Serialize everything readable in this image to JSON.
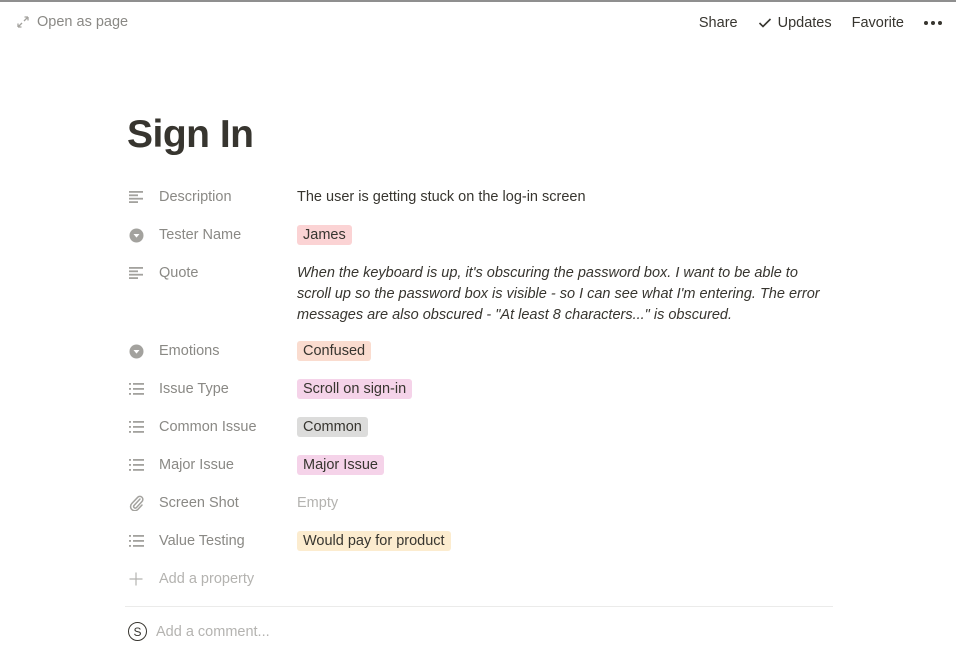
{
  "topbar": {
    "open_as_page": "Open as page",
    "share": "Share",
    "updates": "Updates",
    "favorite": "Favorite"
  },
  "page": {
    "title": "Sign In"
  },
  "properties": [
    {
      "icon": "text-icon",
      "label": "Description",
      "type": "text",
      "value": "The user is getting stuck on the log-in screen"
    },
    {
      "icon": "select-icon",
      "label": "Tester Name",
      "type": "tag",
      "value": "James",
      "color": "#fbd3d4"
    },
    {
      "icon": "text-icon",
      "label": "Quote",
      "type": "quote",
      "value": "When the keyboard is up, it's obscuring the password box. I want to be able to scroll up so the password box is visible - so I can see what I'm entering. The error messages are also obscured - \"At least 8 characters...\" is obscured."
    },
    {
      "icon": "select-icon",
      "label": "Emotions",
      "type": "tag",
      "value": "Confused",
      "color": "#fadccf"
    },
    {
      "icon": "multi-select-icon",
      "label": "Issue Type",
      "type": "tag",
      "value": "Scroll on sign-in",
      "color": "#f5d3e9"
    },
    {
      "icon": "multi-select-icon",
      "label": "Common Issue",
      "type": "tag",
      "value": "Common",
      "color": "#dcdcdb"
    },
    {
      "icon": "multi-select-icon",
      "label": "Major Issue",
      "type": "tag",
      "value": "Major Issue",
      "color": "#f5d3e9"
    },
    {
      "icon": "attachment-icon",
      "label": "Screen Shot",
      "type": "empty",
      "value": "Empty"
    },
    {
      "icon": "multi-select-icon",
      "label": "Value Testing",
      "type": "tag",
      "value": "Would pay for product",
      "color": "#fceccf"
    }
  ],
  "add_property": "Add a property",
  "comment": {
    "avatar_initial": "S",
    "placeholder": "Add a comment..."
  }
}
